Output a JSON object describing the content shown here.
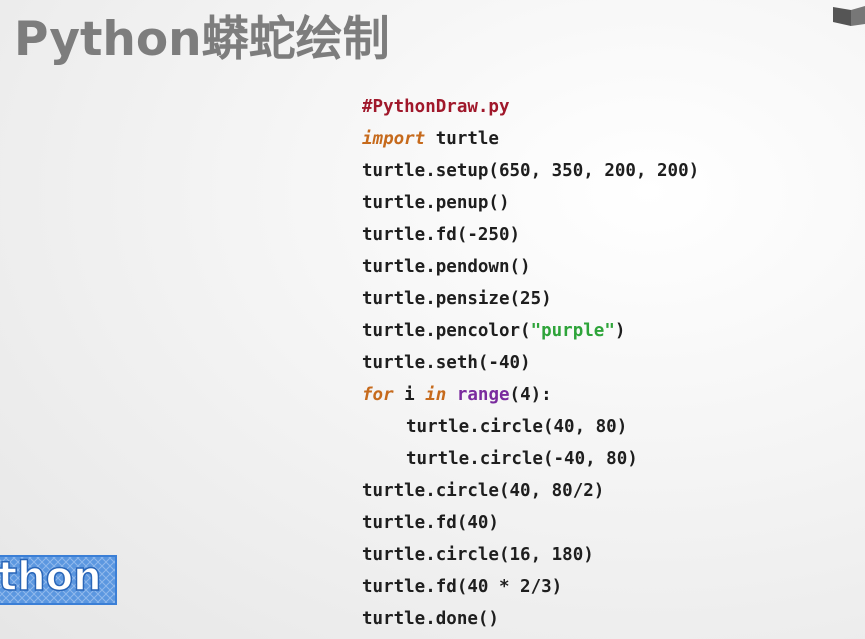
{
  "slide": {
    "title": "Python蟒蛇绘制"
  },
  "logo": {
    "text": "thon"
  },
  "code": {
    "filename_comment": "#PythonDraw.py",
    "line2": {
      "kw": "import",
      "rest": " turtle"
    },
    "line3": "turtle.setup(650, 350, 200, 200)",
    "line4": "turtle.penup()",
    "line5": "turtle.fd(-250)",
    "line6": "turtle.pendown()",
    "line7": "turtle.pensize(25)",
    "line8": {
      "pre": "turtle.pencolor(",
      "str": "\"purple\"",
      "post": ")"
    },
    "line9": "turtle.seth(-40)",
    "line10": {
      "kw1": "for",
      "mid1": " i ",
      "kw2": "in",
      "sp": " ",
      "builtin": "range",
      "post": "(4):"
    },
    "line11": "turtle.circle(40, 80)",
    "line12": "turtle.circle(-40, 80)",
    "line13": "turtle.circle(40, 80/2)",
    "line14": "turtle.fd(40)",
    "line15": "turtle.circle(16, 180)",
    "line16": "turtle.fd(40 * 2/3)",
    "line17": "turtle.done()"
  },
  "colors": {
    "title": "#7d7d7d",
    "comment": "#a0182b",
    "keyword": "#c66a1c",
    "builtin": "#7a2b9e",
    "string": "#2ea43a",
    "logo_blue": "#3b7fd6"
  }
}
